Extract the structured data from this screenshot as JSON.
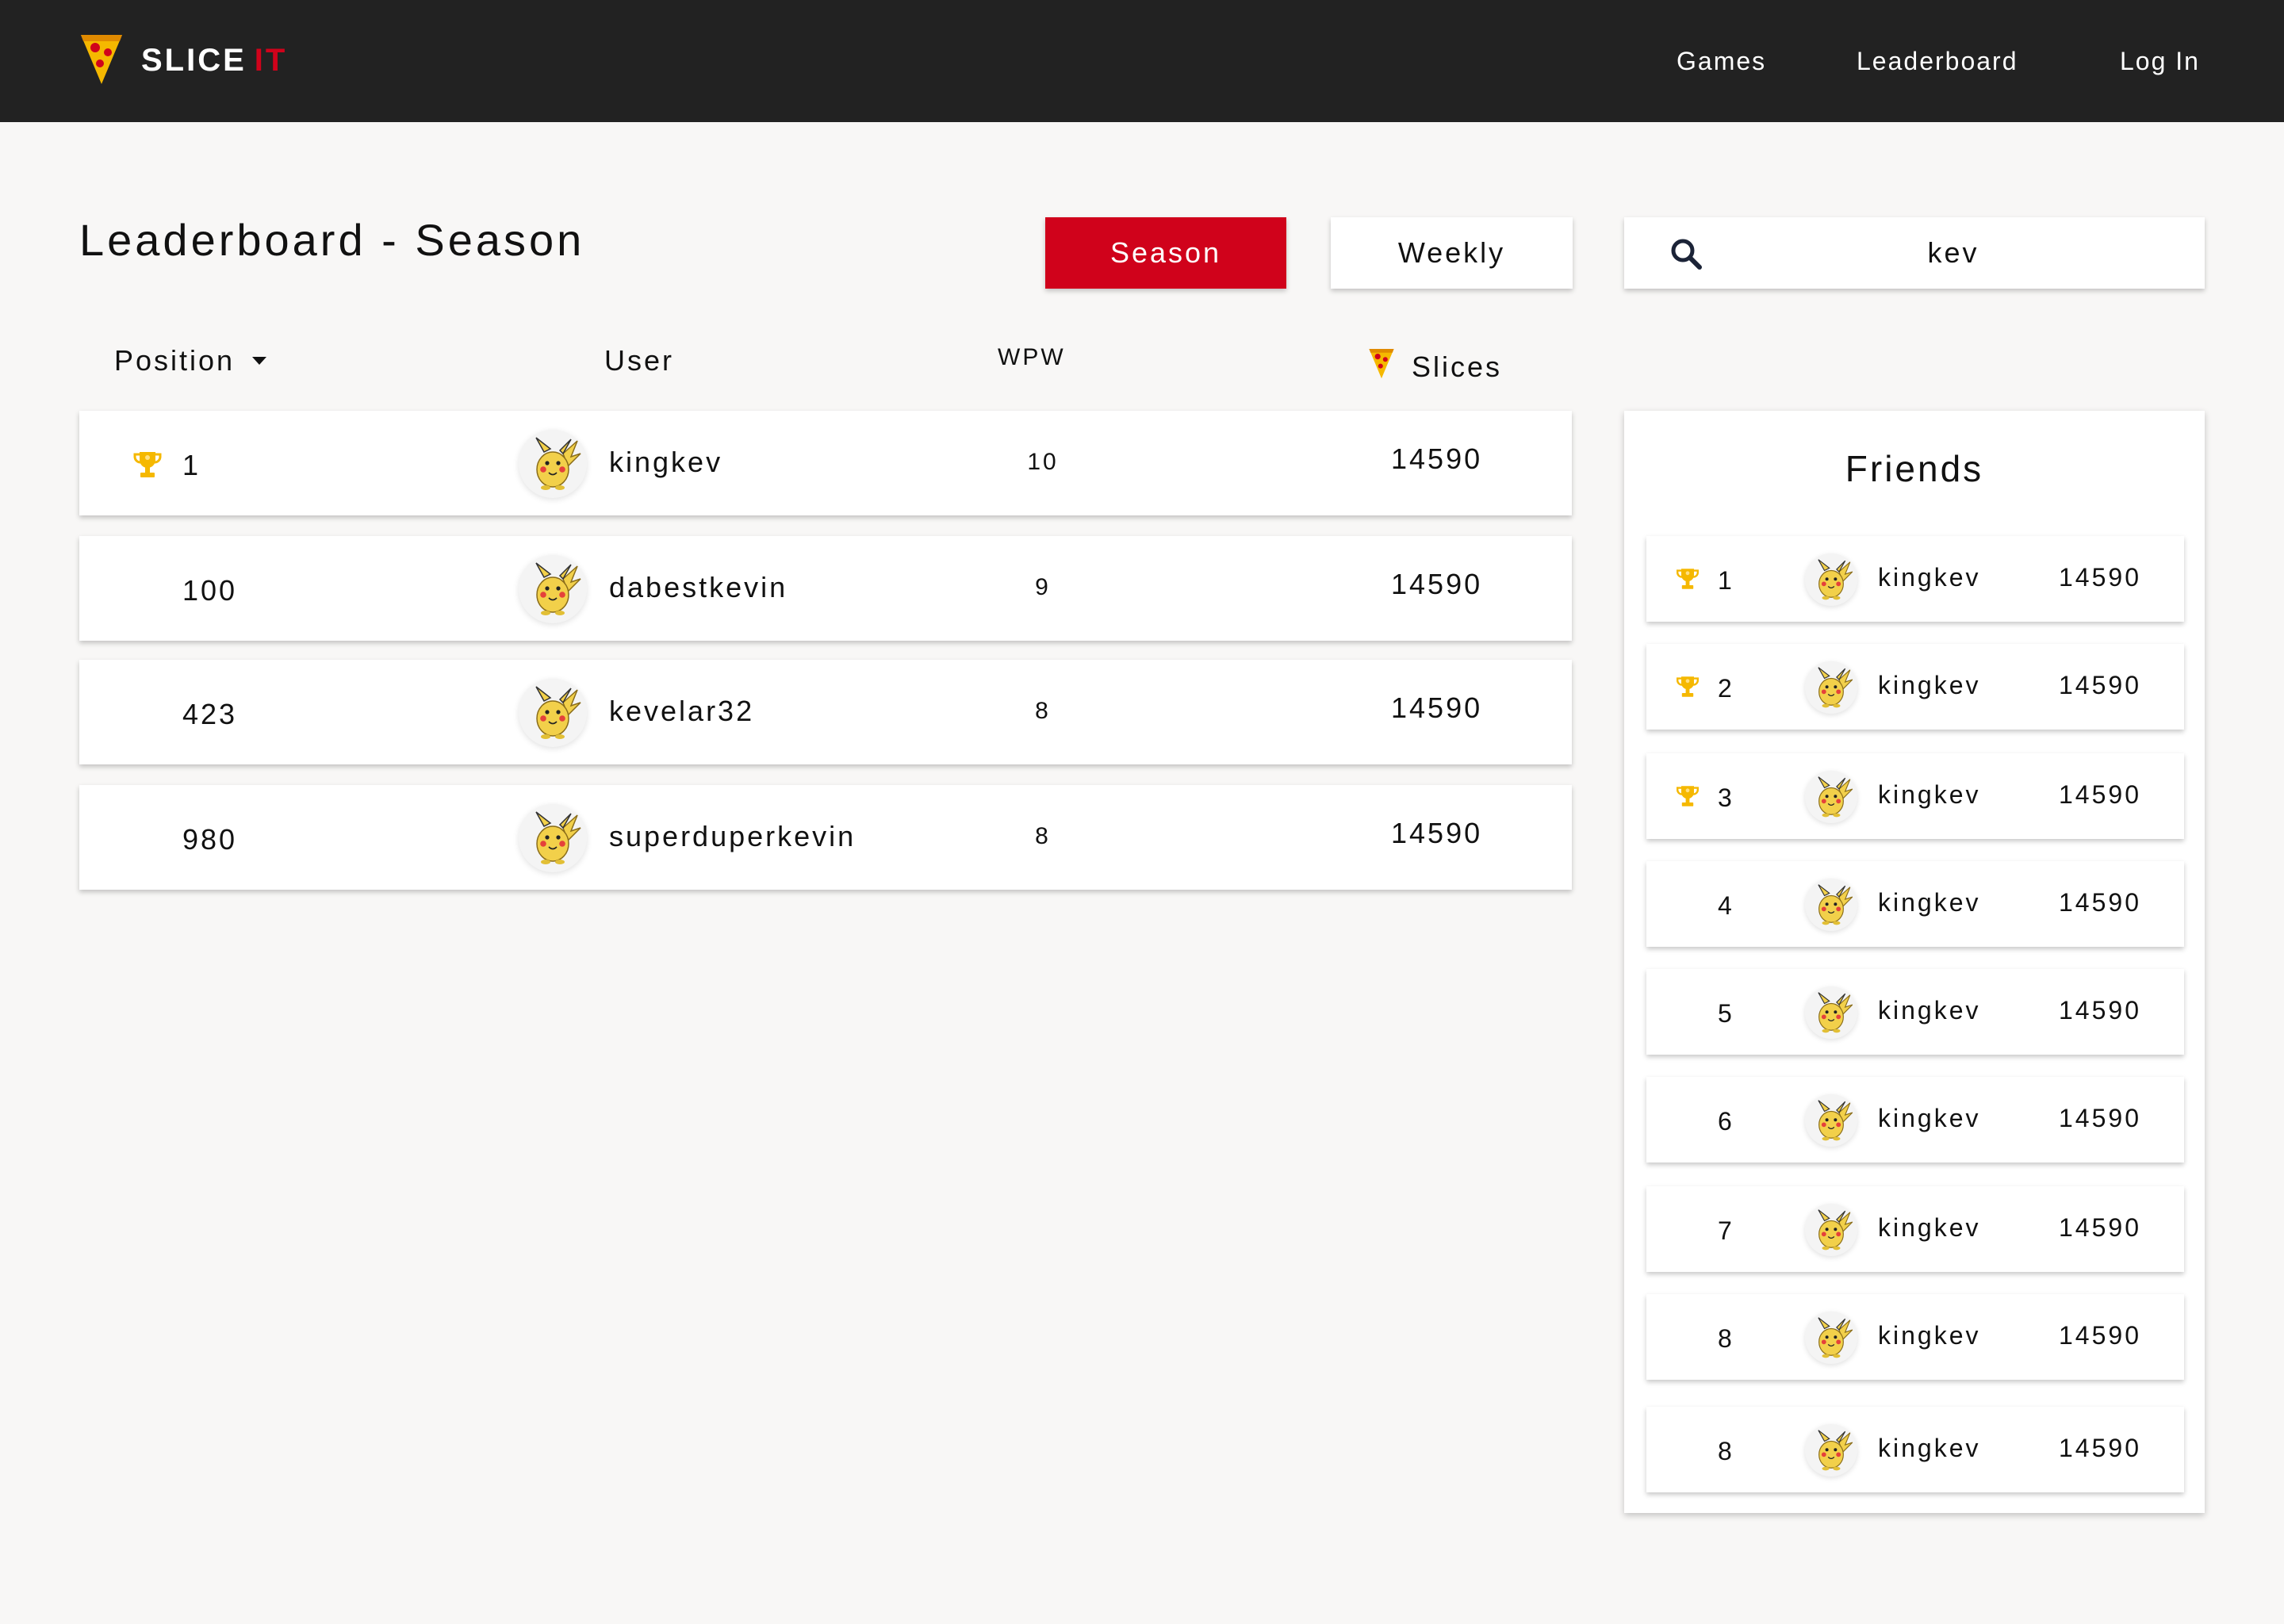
{
  "brand": {
    "name": "SLICE",
    "accent": "IT",
    "accent_color": "#d0021b"
  },
  "nav": {
    "games": "Games",
    "leaderboard": "Leaderboard",
    "login": "Log In"
  },
  "page": {
    "title": "Leaderboard - Season"
  },
  "filters": {
    "season": "Season",
    "weekly": "Weekly",
    "active": "Season"
  },
  "search": {
    "value": "kev"
  },
  "table": {
    "headers": {
      "position": "Position",
      "user": "User",
      "wpw": "WPW",
      "slices": "Slices"
    },
    "rows": [
      {
        "position": "1",
        "trophy": true,
        "user": "kingkev",
        "wpw": "10",
        "slices": "14590"
      },
      {
        "position": "100",
        "trophy": false,
        "user": "dabestkevin",
        "wpw": "9",
        "slices": "14590"
      },
      {
        "position": "423",
        "trophy": false,
        "user": "kevelar32",
        "wpw": "8",
        "slices": "14590"
      },
      {
        "position": "980",
        "trophy": false,
        "user": "superduperkevin",
        "wpw": "8",
        "slices": "14590"
      }
    ]
  },
  "friends": {
    "title": "Friends",
    "rows": [
      {
        "position": "1",
        "trophy": true,
        "user": "kingkev",
        "slices": "14590"
      },
      {
        "position": "2",
        "trophy": true,
        "user": "kingkev",
        "slices": "14590"
      },
      {
        "position": "3",
        "trophy": true,
        "user": "kingkev",
        "slices": "14590"
      },
      {
        "position": "4",
        "trophy": false,
        "user": "kingkev",
        "slices": "14590"
      },
      {
        "position": "5",
        "trophy": false,
        "user": "kingkev",
        "slices": "14590"
      },
      {
        "position": "6",
        "trophy": false,
        "user": "kingkev",
        "slices": "14590"
      },
      {
        "position": "7",
        "trophy": false,
        "user": "kingkev",
        "slices": "14590"
      },
      {
        "position": "8",
        "trophy": false,
        "user": "kingkev",
        "slices": "14590"
      },
      {
        "position": "8",
        "trophy": false,
        "user": "kingkev",
        "slices": "14590"
      }
    ]
  },
  "icons": {
    "logo": "pizza-slice-icon",
    "search": "search-icon",
    "sort": "caret-down-icon",
    "slices": "pizza-slice-icon",
    "trophy": "trophy-icon",
    "avatar": "pikachu-avatar-icon"
  },
  "colors": {
    "topbar": "#222222",
    "primary": "#d0021b",
    "background": "#f8f7f6",
    "trophy": "#f5b800"
  }
}
